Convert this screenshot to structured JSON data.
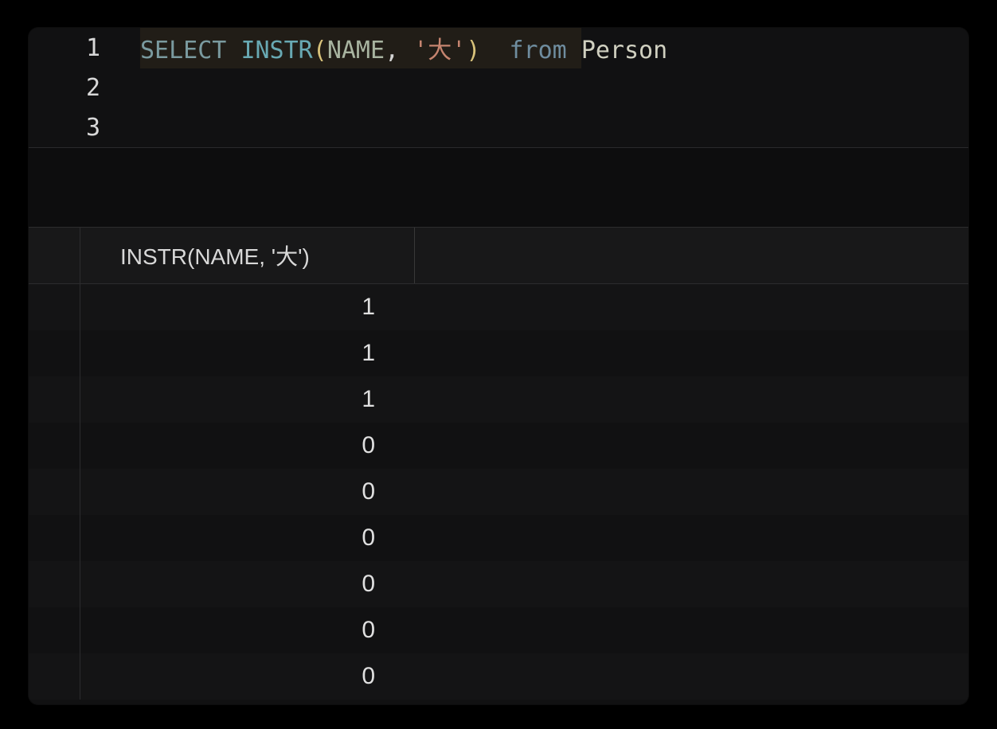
{
  "editor": {
    "lines": [
      {
        "num": "1"
      },
      {
        "num": "2"
      },
      {
        "num": "3"
      }
    ],
    "sql": {
      "select": "SELECT",
      "func": "INSTR",
      "lparen": "(",
      "arg1": "NAME",
      "comma": ",",
      "space1": " ",
      "str": "'大'",
      "rparen": ")",
      "gap": "  ",
      "from": "from",
      "space2": " ",
      "table": "Person"
    }
  },
  "results": {
    "column_header": "INSTR(NAME, '大')",
    "rows": [
      {
        "value": "1"
      },
      {
        "value": "1"
      },
      {
        "value": "1"
      },
      {
        "value": "0"
      },
      {
        "value": "0"
      },
      {
        "value": "0"
      },
      {
        "value": "0"
      },
      {
        "value": "0"
      },
      {
        "value": "0"
      }
    ]
  }
}
